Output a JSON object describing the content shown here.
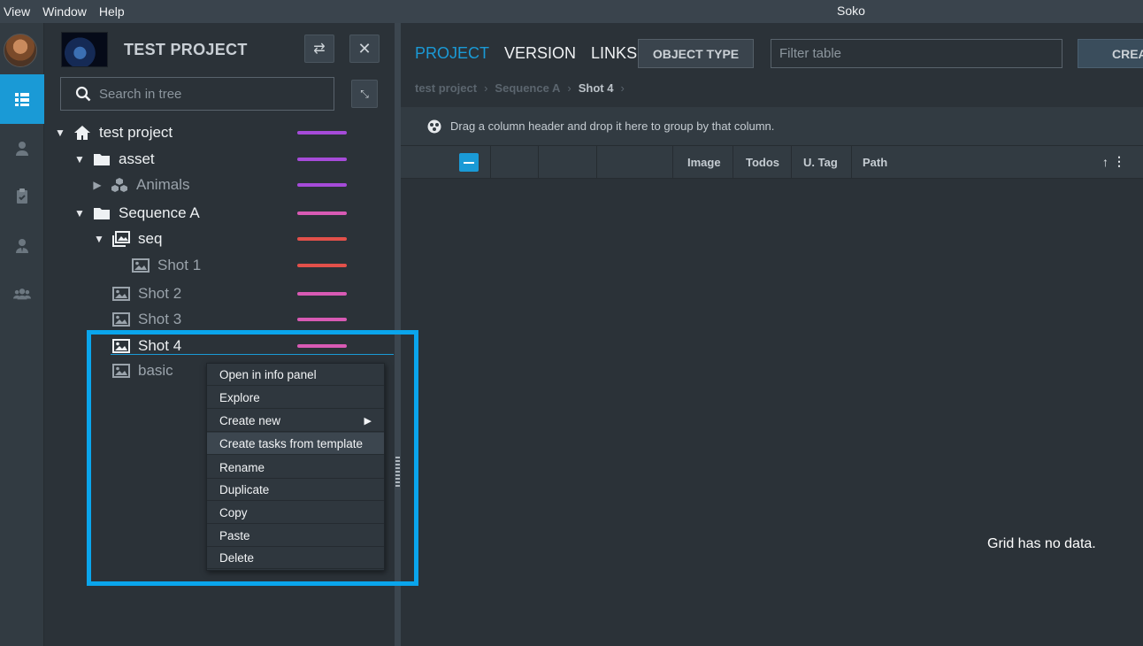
{
  "menubar": {
    "items": [
      "View",
      "Window",
      "Help"
    ],
    "app_title": "Soko"
  },
  "rail": {
    "items": [
      "tree-icon",
      "user-icon",
      "clipboard-check-icon",
      "user-tie-icon",
      "users-icon"
    ],
    "active": "tree-icon"
  },
  "project": {
    "name": "TEST PROJECT",
    "search_placeholder": "Search in tree"
  },
  "tree": [
    {
      "label": "test project",
      "icon": "home-icon",
      "expanded": true,
      "level": 0,
      "color": "#a64bd9"
    },
    {
      "label": "asset",
      "icon": "folder-icon",
      "expanded": true,
      "level": 1,
      "color": "#a64bd9"
    },
    {
      "label": "Animals",
      "icon": "cubes-icon",
      "expanded": false,
      "level": 2,
      "color": "#a64bd9"
    },
    {
      "label": "Sequence A",
      "icon": "folder-icon",
      "expanded": true,
      "level": 1,
      "color": "#d85ab4"
    },
    {
      "label": "seq",
      "icon": "images-icon",
      "expanded": true,
      "level": 2,
      "color": "#e2504a"
    },
    {
      "label": "Shot 1",
      "icon": "image-icon",
      "level": 3,
      "color": "#e2504a"
    },
    {
      "label": "Shot 2",
      "icon": "image-icon",
      "level": 2,
      "color": "#d85ab4"
    },
    {
      "label": "Shot 3",
      "icon": "image-icon",
      "level": 2,
      "color": "#d85ab4"
    },
    {
      "label": "Shot 4",
      "icon": "image-icon",
      "level": 2,
      "color": "#d85ab4",
      "selected": true
    },
    {
      "label": "basic",
      "icon": "image-icon",
      "level": 2
    }
  ],
  "main": {
    "tabs": [
      "PROJECT",
      "VERSION",
      "LINKS"
    ],
    "active_tab": "PROJECT",
    "object_type_label": "OBJECT TYPE",
    "filter_placeholder": "Filter table",
    "create_label": "CREA",
    "breadcrumb": [
      "test project",
      "Sequence A",
      "Shot 4"
    ],
    "group_hint": "Drag a column header and drop it here to group by that column.",
    "columns": [
      "Image",
      "Todos",
      "U. Tag",
      "Path"
    ],
    "empty_message": "Grid has no data."
  },
  "context_menu": {
    "items": [
      {
        "label": "Open in info panel"
      },
      {
        "label": "Explore"
      },
      {
        "label": "Create new",
        "submenu": true
      },
      {
        "label": "Create tasks from template",
        "hover": true
      },
      {
        "label": "Rename"
      },
      {
        "label": "Duplicate"
      },
      {
        "label": "Copy"
      },
      {
        "label": "Paste"
      },
      {
        "label": "Delete"
      }
    ]
  },
  "colors": {
    "accent": "#1a9ad6",
    "highlight": "#0aa5ec"
  }
}
